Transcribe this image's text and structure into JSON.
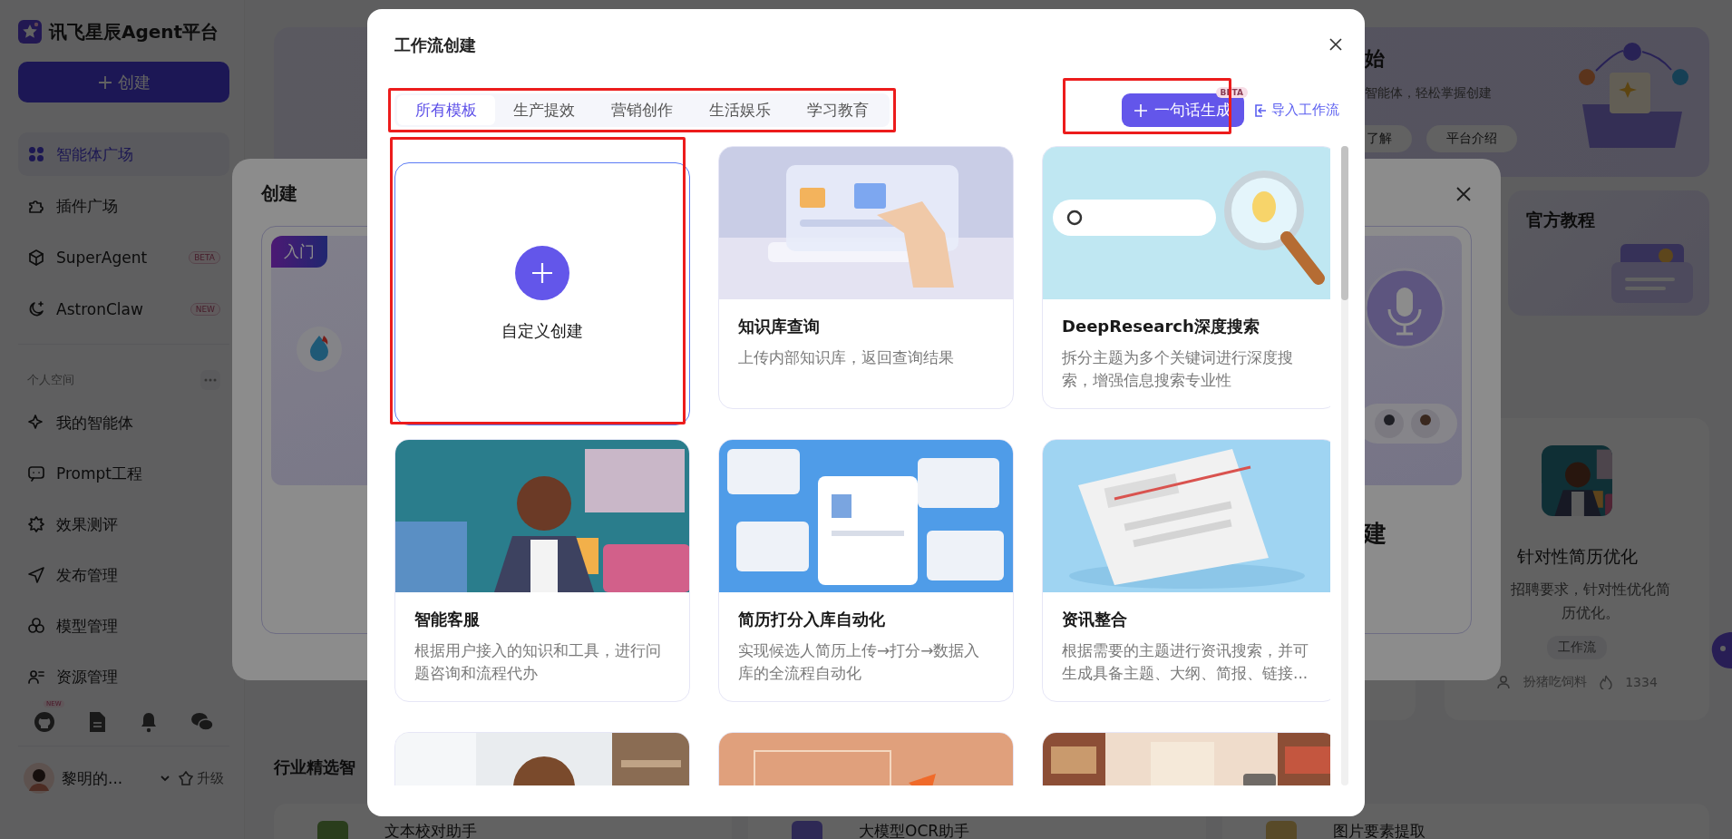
{
  "sidebar": {
    "logo": "讯飞星辰Agent平台",
    "create_button": "创建",
    "nav": [
      {
        "label": "智能体广场",
        "selected": true
      },
      {
        "label": "插件广场",
        "selected": false
      },
      {
        "label": "SuperAgent",
        "selected": false,
        "badge": "BETA"
      },
      {
        "label": "AstronClaw",
        "selected": false,
        "badge": "NEW"
      }
    ],
    "section_title": "个人空间",
    "personal": [
      {
        "label": "我的智能体",
        "selected": false
      },
      {
        "label": "Prompt工程",
        "selected": false
      },
      {
        "label": "效果测评",
        "selected": false
      },
      {
        "label": "发布管理",
        "selected": false
      },
      {
        "label": "模型管理",
        "selected": false
      },
      {
        "label": "资源管理",
        "selected": false
      }
    ],
    "footer_badge": "NEW",
    "user": {
      "name": "黎明的...",
      "upgrade": "升级"
    }
  },
  "background": {
    "banner": {
      "title": "始",
      "subtitle": "智能体，轻松掌握创建",
      "buttons": [
        "了解",
        "平台介绍"
      ]
    },
    "tutorial_card": {
      "title": "官方教程"
    },
    "agent_card": {
      "title": "针对性简历优化",
      "description": "招聘要求，针对性优化简历优化。",
      "tag": "工作流",
      "author": "扮猪吃饲料",
      "count": "1334"
    },
    "section_title": "行业精选智",
    "agents": [
      {
        "name": "文本校对助手"
      },
      {
        "name": "大模型OCR助手"
      },
      {
        "name": "图片要素提取"
      }
    ]
  },
  "create_dialog": {
    "title": "创建",
    "badge": "入门",
    "card_title": "建"
  },
  "workflow_dialog": {
    "title": "工作流创建",
    "tabs": [
      {
        "label": "所有模板",
        "selected": true
      },
      {
        "label": "生产提效",
        "selected": false
      },
      {
        "label": "营销创作",
        "selected": false
      },
      {
        "label": "生活娱乐",
        "selected": false
      },
      {
        "label": "学习教育",
        "selected": false
      }
    ],
    "generate_button": {
      "label": "一句话生成",
      "badge": "BETA"
    },
    "import_link": "导入工作流",
    "templates": [
      {
        "kind": "create",
        "label": "自定义创建"
      },
      {
        "kind": "template",
        "title": "知识库查询",
        "description": "上传内部知识库，返回查询结果"
      },
      {
        "kind": "template",
        "title": "DeepResearch深度搜索",
        "description": "拆分主题为多个关键词进行深度搜索，增强信息搜索专业性"
      },
      {
        "kind": "template",
        "title": "智能客服",
        "description": "根据用户接入的知识和工具，进行问题咨询和流程代办"
      },
      {
        "kind": "template",
        "title": "简历打分入库自动化",
        "description": "实现候选人简历上传→打分→数据入库的全流程自动化"
      },
      {
        "kind": "template",
        "title": "资讯整合",
        "description": "根据需要的主题进行资讯搜索，并可生成具备主题、大纲、简报、链接..."
      },
      {
        "kind": "picture"
      },
      {
        "kind": "picture"
      },
      {
        "kind": "picture"
      }
    ]
  }
}
